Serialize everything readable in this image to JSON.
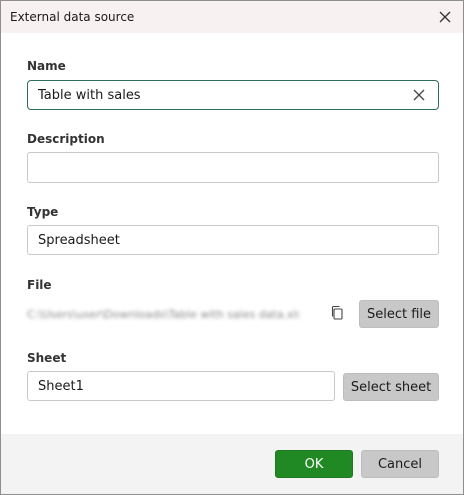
{
  "dialog": {
    "title": "External data source",
    "close_icon": "close-icon"
  },
  "form": {
    "name": {
      "label": "Name",
      "value": "Table with sales",
      "clear_icon": "clear-icon"
    },
    "description": {
      "label": "Description",
      "value": ""
    },
    "type": {
      "label": "Type",
      "value": "Spreadsheet"
    },
    "file": {
      "label": "File",
      "path": "C:\\Users\\user\\Downloads\\Table with sales data.xlsx",
      "copy_icon": "copy-icon",
      "select_label": "Select file"
    },
    "sheet": {
      "label": "Sheet",
      "value": "Sheet1",
      "select_label": "Select sheet"
    }
  },
  "footer": {
    "ok_label": "OK",
    "cancel_label": "Cancel"
  },
  "colors": {
    "ok_button": "#218923",
    "focus_border": "#2e6e5e",
    "titlebar": "#f8f1f1"
  }
}
